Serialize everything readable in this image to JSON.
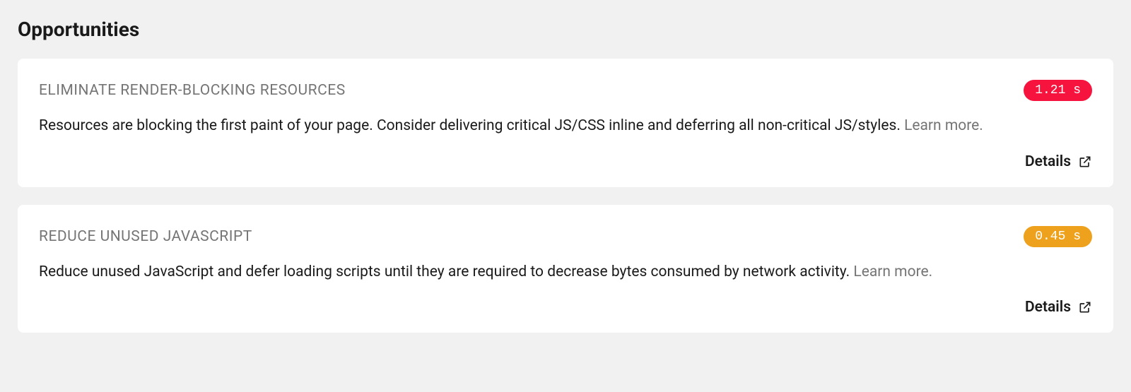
{
  "section": {
    "title": "Opportunities"
  },
  "opportunities": [
    {
      "title": "ELIMINATE RENDER-BLOCKING RESOURCES",
      "badge": "1.21 s",
      "badge_color": "red",
      "description": "Resources are blocking the first paint of your page. Consider delivering critical JS/CSS inline and deferring all non-critical JS/styles. ",
      "learn_more": "Learn more.",
      "details_label": "Details"
    },
    {
      "title": "REDUCE UNUSED JAVASCRIPT",
      "badge": "0.45 s",
      "badge_color": "orange",
      "description": "Reduce unused JavaScript and defer loading scripts until they are required to decrease bytes consumed by network activity. ",
      "learn_more": "Learn more.",
      "details_label": "Details"
    }
  ]
}
